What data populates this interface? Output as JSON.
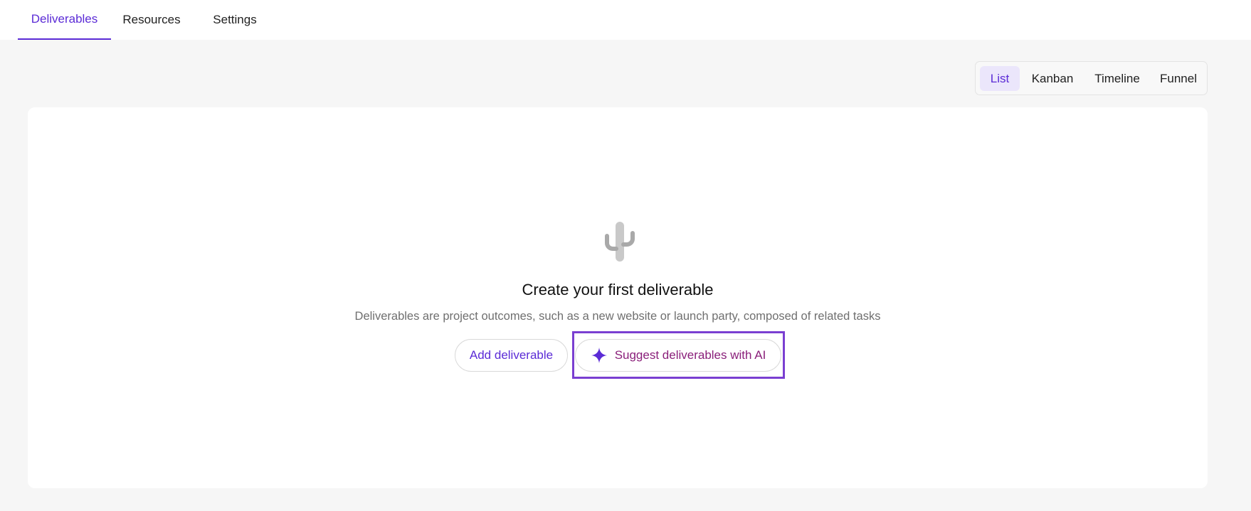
{
  "tabs": {
    "deliverables": "Deliverables",
    "resources": "Resources",
    "settings": "Settings"
  },
  "views": {
    "list": "List",
    "kanban": "Kanban",
    "timeline": "Timeline",
    "funnel": "Funnel"
  },
  "empty_state": {
    "icon": "cactus-icon",
    "title": "Create your first deliverable",
    "description": "Deliverables are project outcomes, such as a new website or launch party, composed of related tasks",
    "add_button": "Add deliverable",
    "ai_button": "Suggest deliverables with AI",
    "ai_icon": "sparkle-icon"
  },
  "colors": {
    "accent": "#5b2bd6",
    "ai_text": "#8a1f7a",
    "highlight": "#7a3fd1"
  }
}
